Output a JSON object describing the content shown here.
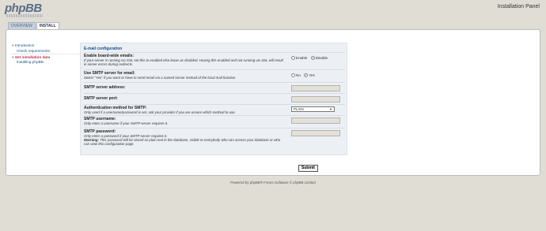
{
  "header": {
    "logo_text": "phpBB",
    "panel_title": "Installation Panel"
  },
  "tabs": [
    {
      "label": "OVERVIEW"
    },
    {
      "label": "INSTALL"
    }
  ],
  "menu": {
    "items": [
      {
        "label": "Introduction",
        "arrow": "»"
      },
      {
        "label": "Check requirements"
      },
      {
        "label": "Set installation data",
        "arrow": "»"
      },
      {
        "label": "Installing phpBB"
      }
    ]
  },
  "form": {
    "legend": "E-mail configuration",
    "board_email": {
      "label": "Enable board-wide emails:",
      "explain": "If your server is running via SSL set this to enabled else leave as disabled. Having this enabled and not running via SSL will result in server errors during redirects.",
      "options": [
        "Enable",
        "Disable"
      ],
      "selected": "Disable"
    },
    "smtp_enable": {
      "label": "Use SMTP server for email:",
      "explain": "Select “Yes” if you want or have to send email via a named server instead of the local mail function",
      "options": [
        "No",
        "Yes"
      ],
      "selected": "Yes"
    },
    "smtp_host": {
      "label": "SMTP server address:",
      "value": ""
    },
    "smtp_port": {
      "label": "SMTP server port:",
      "value": ""
    },
    "smtp_auth": {
      "label": "Authentication method for SMTP:",
      "explain": "Only used if a username/password is set, ask your provider if you are unsure which method to use.",
      "value": "PLAIN"
    },
    "smtp_user": {
      "label": "SMTP username:",
      "explain": "Only enter a username if your SMTP server requires it.",
      "value": ""
    },
    "smtp_pass": {
      "label": "SMTP password:",
      "explain1": "Only enter a password if your SMTP server requires it.",
      "warning_label": "Warning:",
      "explain2": "This password will be stored as plain text in the database, visible to everybody who can access your database or who can view this configuration page.",
      "value": ""
    },
    "submit_label": "Submit"
  },
  "footer": {
    "text": "Powered by phpBB® Forum Software © phpBB Limited"
  }
}
